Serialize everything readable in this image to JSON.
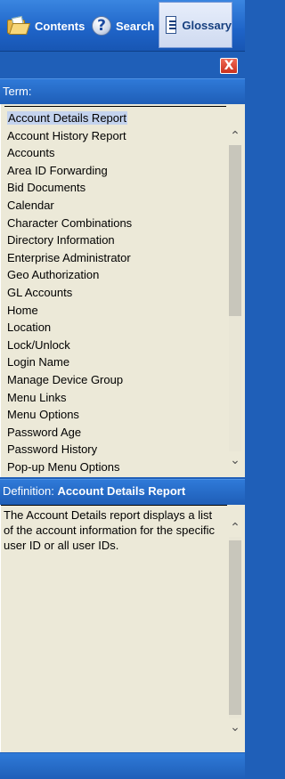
{
  "tabs": {
    "contents": "Contents",
    "search": "Search",
    "glossary": "Glossary"
  },
  "close_label": "X",
  "term_header": "Term:",
  "terms": [
    "Account Details Report",
    "Account History Report",
    "Accounts",
    "Area ID Forwarding",
    "Bid Documents",
    "Calendar",
    "Character Combinations",
    "Directory Information",
    "Enterprise Administrator",
    "Geo Authorization",
    "GL Accounts",
    "Home",
    "Location",
    "Lock/Unlock",
    "Login Name",
    "Manage Device Group",
    "Menu Links",
    "Menu Options",
    "Password Age",
    "Password History",
    "Pop-up Menu Options"
  ],
  "selected_term_index": 0,
  "definition": {
    "label": "Definition:",
    "term": "Account Details Report",
    "text": "The Account Details report displays a list of the account information for the specific user ID or all user IDs."
  },
  "icons": {
    "contents": "folder-icon",
    "search": "help-icon",
    "glossary": "glossary-icon",
    "close": "close-icon",
    "scroll_up": "chevron-up-icon",
    "scroll_down": "chevron-down-icon"
  },
  "colors": {
    "bar_blue": "#1f5fb8",
    "panel_bg": "#ece9d8",
    "selection": "#c4d3ee",
    "close_red": "#d9402b"
  }
}
